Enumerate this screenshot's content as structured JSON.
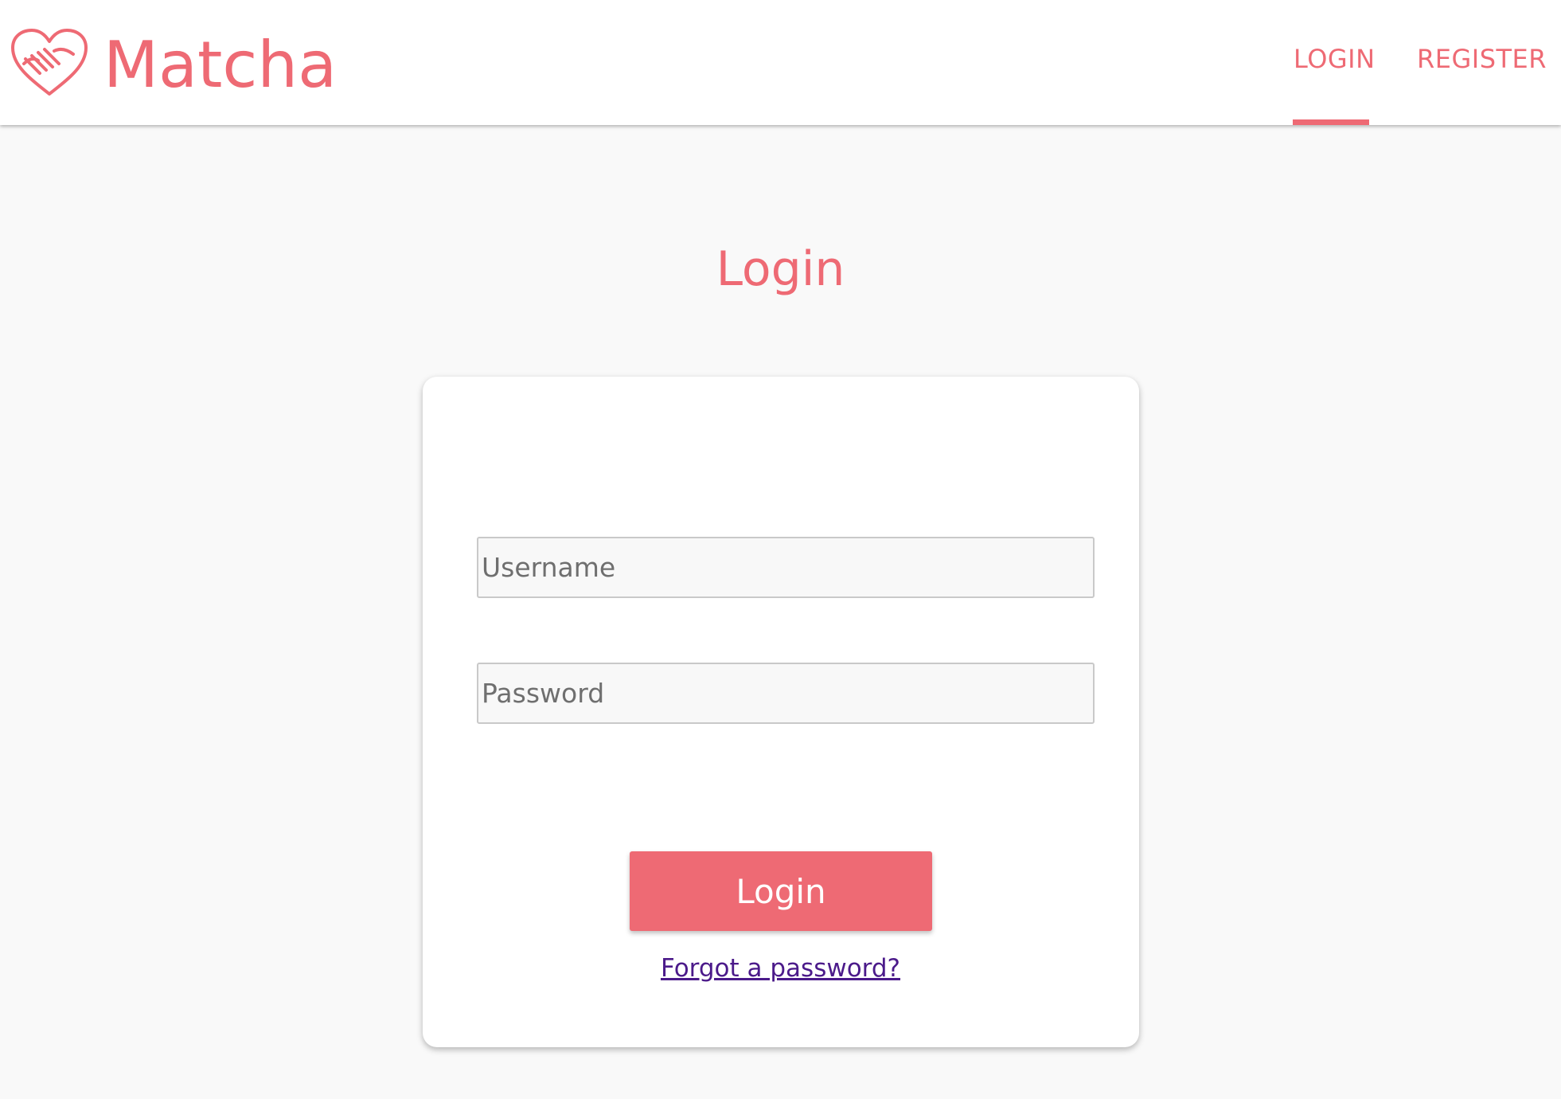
{
  "header": {
    "brand": "Matcha",
    "logo_icon": "handshake-heart-icon",
    "nav": {
      "login_label": "LOGIN",
      "register_label": "REGISTER",
      "active": "login"
    }
  },
  "main": {
    "title": "Login",
    "form": {
      "username_placeholder": "Username",
      "username_value": "",
      "password_placeholder": "Password",
      "password_value": "",
      "submit_label": "Login",
      "forgot_label": "Forgot a password?"
    }
  },
  "colors": {
    "accent": "#ee6a74",
    "background": "#f9f9f9",
    "link": "#4b1a8a"
  }
}
